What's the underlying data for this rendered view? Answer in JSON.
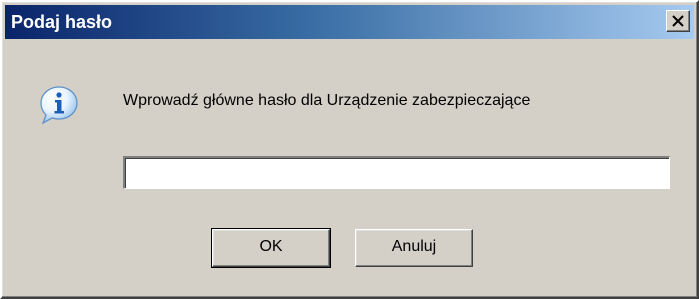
{
  "window": {
    "title": "Podaj hasło",
    "close_symbol": "×",
    "titlebar_colors": [
      "#0a246a",
      "#a6caf0"
    ],
    "background_color": "#d4d0c8"
  },
  "icon": {
    "name": "info-icon",
    "glyph": "i",
    "color": "#1c5fb8"
  },
  "message": "Wprowadź główne hasło dla Urządzenie zabezpieczające",
  "password_field": {
    "value": "",
    "placeholder": ""
  },
  "buttons": {
    "ok_label": "OK",
    "cancel_label": "Anuluj"
  }
}
